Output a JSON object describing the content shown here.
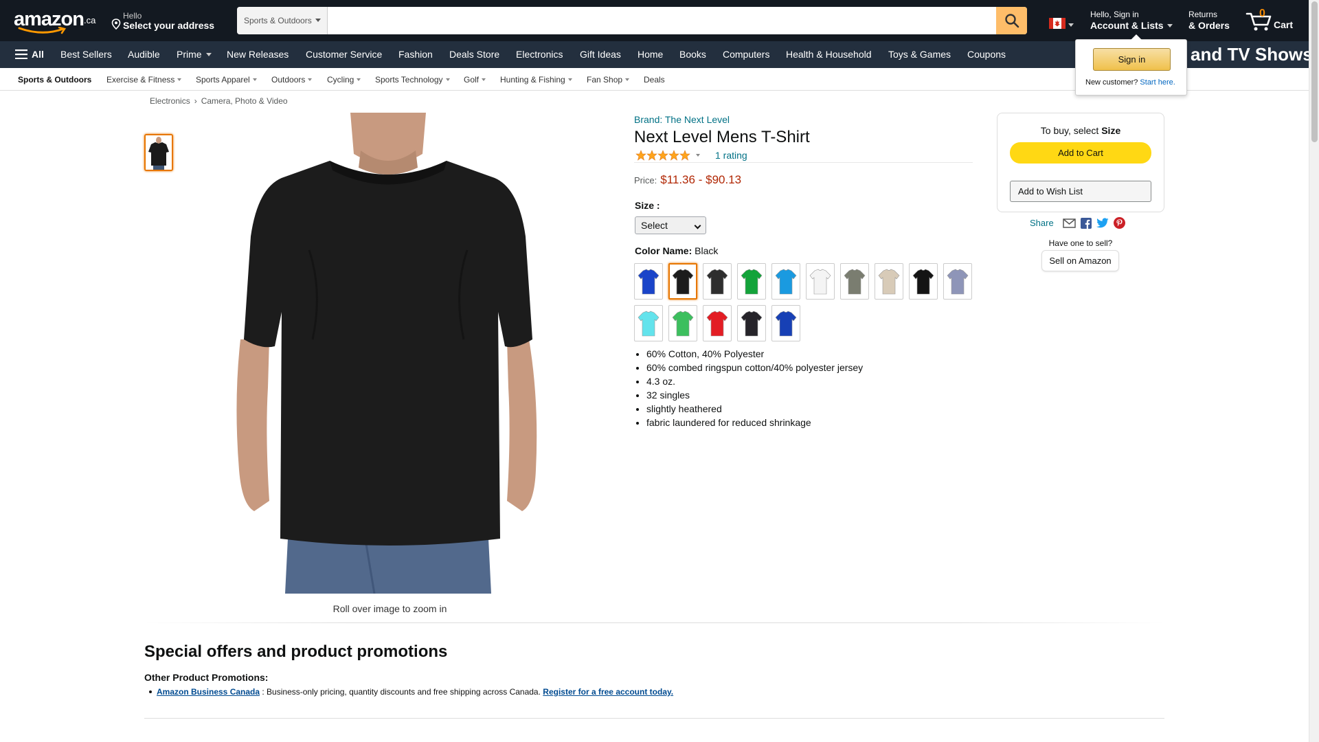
{
  "header": {
    "logo_text": "amazon",
    "logo_tld": ".ca",
    "address_line1": "Hello",
    "address_line2": "Select your address",
    "search_category": "Sports & Outdoors",
    "search_placeholder": "",
    "account_line1": "Hello, Sign in",
    "account_line2": "Account & Lists",
    "returns_line1": "Returns",
    "returns_line2": "& Orders",
    "cart_count": "0",
    "cart_label": "Cart",
    "colors": {
      "nav_bg": "#131921",
      "subnav_bg": "#232f3e",
      "search_button": "#febd69",
      "cart_count": "#f08804"
    }
  },
  "subnav": {
    "all_label": "All",
    "items": [
      "Best Sellers",
      "Audible",
      "Prime",
      "New Releases",
      "Customer Service",
      "Fashion",
      "Deals Store",
      "Electronics",
      "Gift Ideas",
      "Home",
      "Books",
      "Computers",
      "Health & Household",
      "Toys & Games",
      "Coupons"
    ],
    "promo_text": "and TV Shows"
  },
  "flyout": {
    "signin_label": "Sign in",
    "new_customer": "New customer?",
    "start_here": "Start here."
  },
  "category_bar": {
    "items": [
      "Sports & Outdoors",
      "Exercise & Fitness",
      "Sports Apparel",
      "Outdoors",
      "Cycling",
      "Sports Technology",
      "Golf",
      "Hunting & Fishing",
      "Fan Shop",
      "Deals"
    ]
  },
  "breadcrumb": [
    "Electronics",
    "Camera, Photo & Video"
  ],
  "image": {
    "rollover_text": "Roll over image to zoom in"
  },
  "product": {
    "brand": "Brand: The Next Level",
    "title": "Next Level Mens T-Shirt",
    "rating_stars": 5,
    "rating_count": "1 rating",
    "price_label": "Price:",
    "price_low": "$11.36",
    "price_sep": "-",
    "price_high": "$90.13",
    "size_label": "Size :",
    "size_value": "Select",
    "color_label": "Color Name:",
    "color_value": "Black",
    "swatches": [
      "#1a44c9",
      "#1c1c1c",
      "#2e2e2e",
      "#13a33a",
      "#1a9ae0",
      "#f4f4f4",
      "#7a7d70",
      "#d8cbb8",
      "#141414",
      "#8e95b8",
      "#63e3ec",
      "#3cbf5e",
      "#e31d24",
      "#26242a",
      "#1740b5"
    ],
    "selected_swatch_index": 1,
    "bullets": [
      "60% Cotton, 40% Polyester",
      "60% combed ringspun cotton/40% polyester jersey",
      "4.3 oz.",
      "32 singles",
      "slightly heathered",
      "fabric laundered for reduced shrinkage"
    ],
    "colors": {
      "link": "#007185",
      "price": "#b12704",
      "star": "#ffa41c"
    }
  },
  "buybox": {
    "to_buy_prefix": "To buy, select",
    "to_buy_bold": "Size",
    "add_to_cart": "Add to Cart",
    "add_to_wishlist": "Add to Wish List",
    "share_label": "Share",
    "sell_question": "Have one to sell?",
    "sell_button": "Sell on Amazon",
    "colors": {
      "add_to_cart": "#ffd814"
    }
  },
  "promotions": {
    "title": "Special offers and product promotions",
    "subtitle": "Other Product Promotions:",
    "link_text": "Amazon Business Canada",
    "body_text": " : Business-only pricing, quantity discounts and free shipping across Canada. ",
    "register_link": "Register for a free account today."
  }
}
